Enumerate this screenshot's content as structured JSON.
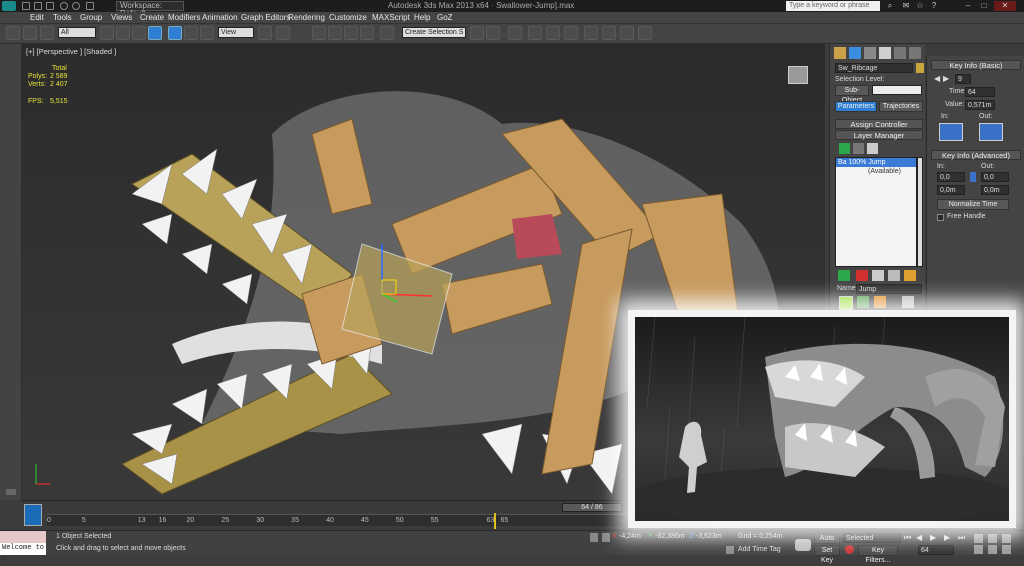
{
  "titlebar": {
    "workspace": "Workspace: Default",
    "title": "Autodesk 3ds Max 2013 x64",
    "file": "Swallower-Jump].max",
    "search_placeholder": "Type a keyword or phrase"
  },
  "menu": [
    "Edit",
    "Tools",
    "Group",
    "Views",
    "Create",
    "Modifiers",
    "Animation",
    "Graph Editors",
    "Rendering",
    "Customize",
    "MAXScript",
    "Help",
    "GoZ"
  ],
  "toolbar": {
    "filter": "All",
    "ref_coord": "View",
    "selection_set": "Create Selection S"
  },
  "viewport": {
    "label": "[+] [Perspective ] [Shaded ]",
    "stats": {
      "total_label": "Total",
      "polys_label": "Polys:",
      "polys": "2 589",
      "verts_label": "Verts:",
      "verts": "2 407",
      "fps_label": "FPS:",
      "fps": "5,515"
    }
  },
  "command_panel": {
    "object_name": "Sw_Ribcage",
    "selection_level_label": "Selection Level:",
    "sub_object": "Sub-Object",
    "tab_parameters": "Parameters",
    "tab_trajectories": "Trajectories",
    "assign_controller": "Assign Controller",
    "layer_manager": "Layer Manager",
    "layers": [
      {
        "name": "Ba 100% Jump"
      },
      {
        "name": "(Available)"
      }
    ],
    "name_label": "Name:",
    "name_value": "Jump"
  },
  "key_info": {
    "basic_title": "Key Info (Basic)",
    "key_number": "9",
    "time_label": "Time:",
    "time_value": "64",
    "value_label": "Value:",
    "value_value": "0,571m",
    "in_label": "In:",
    "out_label": "Out:",
    "advanced_title": "Key Info (Advanced)",
    "adv_in": "In:",
    "adv_out": "Out:",
    "adv_values": [
      "0,0",
      "0,0",
      "0,0m",
      "0,0m"
    ],
    "normalize_time": "Normalize Time",
    "free_handle": "Free Handle"
  },
  "timeline": {
    "frame_counter": "64 / 86",
    "ticks": [
      "0",
      "5",
      "13",
      "16",
      "20",
      "25",
      "30",
      "35",
      "40",
      "45",
      "50",
      "55",
      "63",
      "65"
    ],
    "current_frame": 64,
    "total_frames": 86
  },
  "status": {
    "maxscript": "Welcome to :",
    "objects_selected": "1 Object Selected",
    "prompt": "Click and drag to select and move objects",
    "x": "-4,24m",
    "y": "-82,386m",
    "z": "-3,623m",
    "grid": "Grid = 0,254m",
    "auto_key": "Auto Key",
    "key_mode": "Selected",
    "set_key": "Set Key",
    "key_filters": "Key Filters...",
    "add_time_tag": "Add Time Tag",
    "frame": "64"
  }
}
